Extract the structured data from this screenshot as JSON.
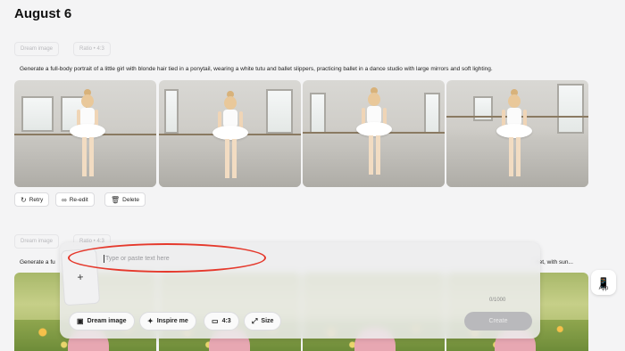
{
  "header": {
    "date": "August 6"
  },
  "section1": {
    "tags": [
      "Dream image",
      "Ratio • 4:3"
    ],
    "prompt": "Generate a full-body portrait of a little girl with blonde hair tied in a ponytail, wearing a white tutu and ballet slippers, practicing ballet in a dance studio with large mirrors and soft lighting.",
    "actions": {
      "retry": "Retry",
      "reedit": "Re-edit",
      "delete": "Delete"
    }
  },
  "section2": {
    "tags": [
      "Dream image",
      "Ratio • 4:3"
    ],
    "prompt_start": "Generate a fu",
    "prompt_end": "net, with sun..."
  },
  "composer": {
    "placeholder": "Type or paste text here",
    "upload_label": "+",
    "counter": "0/1000",
    "buttons": {
      "dream_image": "Dream image",
      "inspire_me": "Inspire me",
      "ratio": "4:3",
      "size": "Size",
      "create": "Create"
    }
  },
  "app_button": {
    "label": "App"
  },
  "icons": {
    "retry": "refresh-icon",
    "reedit": "link-icon",
    "delete": "trash-icon",
    "dream": "image-icon",
    "inspire": "magic-wand-icon",
    "ratio": "aspect-ratio-icon",
    "size": "resize-icon",
    "app": "phone-icon"
  },
  "colors": {
    "annotation": "#e5392c",
    "create_disabled": "#b9b9bc"
  }
}
